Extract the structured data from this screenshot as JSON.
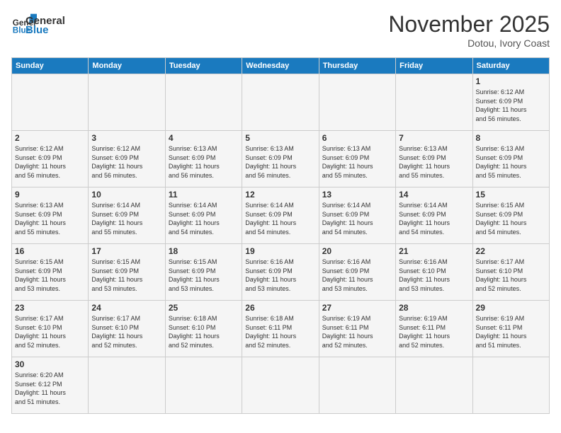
{
  "header": {
    "logo_general": "General",
    "logo_blue": "Blue",
    "month_title": "November 2025",
    "location": "Dotou, Ivory Coast"
  },
  "weekdays": [
    "Sunday",
    "Monday",
    "Tuesday",
    "Wednesday",
    "Thursday",
    "Friday",
    "Saturday"
  ],
  "weeks": [
    [
      {
        "day": "",
        "info": ""
      },
      {
        "day": "",
        "info": ""
      },
      {
        "day": "",
        "info": ""
      },
      {
        "day": "",
        "info": ""
      },
      {
        "day": "",
        "info": ""
      },
      {
        "day": "",
        "info": ""
      },
      {
        "day": "1",
        "info": "Sunrise: 6:12 AM\nSunset: 6:09 PM\nDaylight: 11 hours\nand 56 minutes."
      }
    ],
    [
      {
        "day": "2",
        "info": "Sunrise: 6:12 AM\nSunset: 6:09 PM\nDaylight: 11 hours\nand 56 minutes."
      },
      {
        "day": "3",
        "info": "Sunrise: 6:12 AM\nSunset: 6:09 PM\nDaylight: 11 hours\nand 56 minutes."
      },
      {
        "day": "4",
        "info": "Sunrise: 6:13 AM\nSunset: 6:09 PM\nDaylight: 11 hours\nand 56 minutes."
      },
      {
        "day": "5",
        "info": "Sunrise: 6:13 AM\nSunset: 6:09 PM\nDaylight: 11 hours\nand 56 minutes."
      },
      {
        "day": "6",
        "info": "Sunrise: 6:13 AM\nSunset: 6:09 PM\nDaylight: 11 hours\nand 55 minutes."
      },
      {
        "day": "7",
        "info": "Sunrise: 6:13 AM\nSunset: 6:09 PM\nDaylight: 11 hours\nand 55 minutes."
      },
      {
        "day": "8",
        "info": "Sunrise: 6:13 AM\nSunset: 6:09 PM\nDaylight: 11 hours\nand 55 minutes."
      }
    ],
    [
      {
        "day": "9",
        "info": "Sunrise: 6:13 AM\nSunset: 6:09 PM\nDaylight: 11 hours\nand 55 minutes."
      },
      {
        "day": "10",
        "info": "Sunrise: 6:14 AM\nSunset: 6:09 PM\nDaylight: 11 hours\nand 55 minutes."
      },
      {
        "day": "11",
        "info": "Sunrise: 6:14 AM\nSunset: 6:09 PM\nDaylight: 11 hours\nand 54 minutes."
      },
      {
        "day": "12",
        "info": "Sunrise: 6:14 AM\nSunset: 6:09 PM\nDaylight: 11 hours\nand 54 minutes."
      },
      {
        "day": "13",
        "info": "Sunrise: 6:14 AM\nSunset: 6:09 PM\nDaylight: 11 hours\nand 54 minutes."
      },
      {
        "day": "14",
        "info": "Sunrise: 6:14 AM\nSunset: 6:09 PM\nDaylight: 11 hours\nand 54 minutes."
      },
      {
        "day": "15",
        "info": "Sunrise: 6:15 AM\nSunset: 6:09 PM\nDaylight: 11 hours\nand 54 minutes."
      }
    ],
    [
      {
        "day": "16",
        "info": "Sunrise: 6:15 AM\nSunset: 6:09 PM\nDaylight: 11 hours\nand 53 minutes."
      },
      {
        "day": "17",
        "info": "Sunrise: 6:15 AM\nSunset: 6:09 PM\nDaylight: 11 hours\nand 53 minutes."
      },
      {
        "day": "18",
        "info": "Sunrise: 6:15 AM\nSunset: 6:09 PM\nDaylight: 11 hours\nand 53 minutes."
      },
      {
        "day": "19",
        "info": "Sunrise: 6:16 AM\nSunset: 6:09 PM\nDaylight: 11 hours\nand 53 minutes."
      },
      {
        "day": "20",
        "info": "Sunrise: 6:16 AM\nSunset: 6:09 PM\nDaylight: 11 hours\nand 53 minutes."
      },
      {
        "day": "21",
        "info": "Sunrise: 6:16 AM\nSunset: 6:10 PM\nDaylight: 11 hours\nand 53 minutes."
      },
      {
        "day": "22",
        "info": "Sunrise: 6:17 AM\nSunset: 6:10 PM\nDaylight: 11 hours\nand 52 minutes."
      }
    ],
    [
      {
        "day": "23",
        "info": "Sunrise: 6:17 AM\nSunset: 6:10 PM\nDaylight: 11 hours\nand 52 minutes."
      },
      {
        "day": "24",
        "info": "Sunrise: 6:17 AM\nSunset: 6:10 PM\nDaylight: 11 hours\nand 52 minutes."
      },
      {
        "day": "25",
        "info": "Sunrise: 6:18 AM\nSunset: 6:10 PM\nDaylight: 11 hours\nand 52 minutes."
      },
      {
        "day": "26",
        "info": "Sunrise: 6:18 AM\nSunset: 6:11 PM\nDaylight: 11 hours\nand 52 minutes."
      },
      {
        "day": "27",
        "info": "Sunrise: 6:19 AM\nSunset: 6:11 PM\nDaylight: 11 hours\nand 52 minutes."
      },
      {
        "day": "28",
        "info": "Sunrise: 6:19 AM\nSunset: 6:11 PM\nDaylight: 11 hours\nand 52 minutes."
      },
      {
        "day": "29",
        "info": "Sunrise: 6:19 AM\nSunset: 6:11 PM\nDaylight: 11 hours\nand 51 minutes."
      }
    ],
    [
      {
        "day": "30",
        "info": "Sunrise: 6:20 AM\nSunset: 6:12 PM\nDaylight: 11 hours\nand 51 minutes."
      },
      {
        "day": "",
        "info": ""
      },
      {
        "day": "",
        "info": ""
      },
      {
        "day": "",
        "info": ""
      },
      {
        "day": "",
        "info": ""
      },
      {
        "day": "",
        "info": ""
      },
      {
        "day": "",
        "info": ""
      }
    ]
  ]
}
